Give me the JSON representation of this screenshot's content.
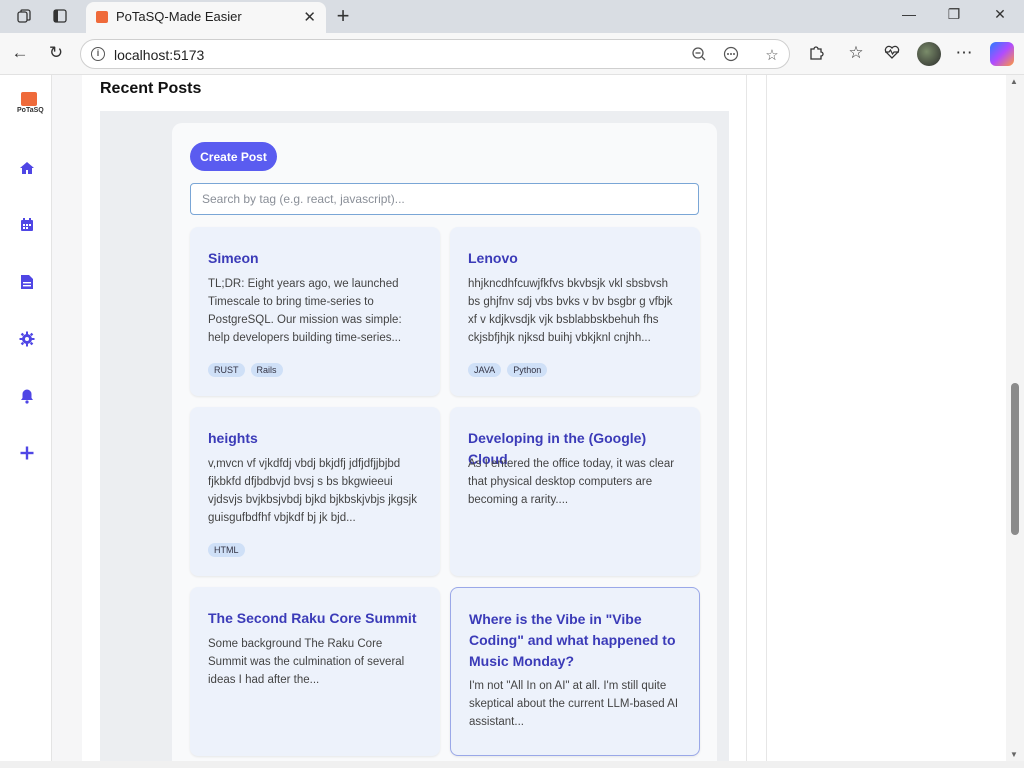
{
  "browser": {
    "tab_title": "PoTaSQ-Made Easier",
    "url": "localhost:5173",
    "icons": [
      "workspaces-icon",
      "vertical-tabs-icon",
      "close-tab-icon",
      "new-tab-icon",
      "minimize-icon",
      "restore-icon",
      "close-window-icon",
      "back-icon",
      "reload-icon",
      "site-info-icon",
      "zoom-out-icon",
      "read-aloud-icon",
      "favorite-star-icon",
      "extensions-icon",
      "favorites-icon",
      "browser-health-icon",
      "profile-avatar",
      "more-icon",
      "copilot-icon"
    ]
  },
  "sidebar": {
    "logo_text": "PoTaSQ",
    "items": [
      {
        "icon": "home-icon"
      },
      {
        "icon": "calendar-icon"
      },
      {
        "icon": "document-icon"
      },
      {
        "icon": "settings-icon"
      },
      {
        "icon": "bell-icon"
      },
      {
        "icon": "plus-icon"
      }
    ],
    "accent_color": "#4f46e5"
  },
  "main": {
    "section_title": "Recent Posts",
    "create_button": "Create Post",
    "search_placeholder": "Search by tag (e.g. react, javascript)...",
    "posts": [
      {
        "title": "Simeon",
        "body": "TL;DR: Eight years ago, we launched Timescale to bring time-series to PostgreSQL. Our mission was simple: help developers building time-series...",
        "tags": [
          "RUST",
          "Rails"
        ]
      },
      {
        "title": "Lenovo",
        "body": "hhjkncdhfcuwjfkfvs bkvbsjk vkl sbsbvsh bs ghjfnv sdj vbs bvks v bv bsgbr g vfbjk xf v kdjkvsdjk vjk bsblabbskbehuh fhs ckjsbfjhjk njksd buihj vbkjknl cnjhh...",
        "tags": [
          "JAVA",
          "Python"
        ]
      },
      {
        "title": "heights",
        "body": "v,mvcn vf vjkdfdj vbdj bkjdfj jdfjdfjjbjbd fjkbkfd dfjbdbvjd bvsj s bs bkgwieeui vjdsvjs bvjkbsjvbdj bjkd bjkbskjvbjs jkgsjk guisgufbdfhf vbjkdf bj jk bjd...",
        "tags": [
          "HTML"
        ]
      },
      {
        "title": "Developing in the (Google) Cloud",
        "body": "As I entered the office today, it was clear that physical desktop computers are becoming a rarity....",
        "tags": []
      },
      {
        "title": "The Second Raku Core Summit",
        "body": "Some background The Raku Core Summit was the culmination of several ideas I had after the...",
        "tags": []
      },
      {
        "title": "Where is the Vibe in \"Vibe Coding\" and what happened to Music Monday?",
        "body": "I'm not \"All In on AI\" at all. I'm still quite skeptical about the current LLM-based AI assistant...",
        "tags": []
      }
    ]
  },
  "colors": {
    "primary_button": "#5a5cf0",
    "card_background": "#edf2fb",
    "card_title": "#3b3bb8",
    "tag_background": "#cfe0f7"
  }
}
